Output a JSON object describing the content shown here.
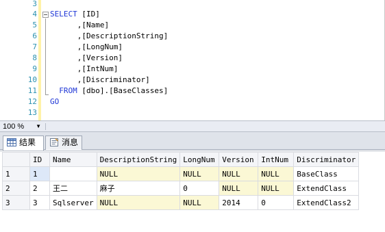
{
  "editor": {
    "line_numbers": [
      "3",
      "4",
      "5",
      "6",
      "7",
      "8",
      "9",
      "10",
      "11",
      "12",
      "13"
    ],
    "lines": [
      {
        "keyword": "",
        "text": ""
      },
      {
        "keyword": "SELECT",
        "text": " [ID]"
      },
      {
        "keyword": "",
        "text": "      ,[Name]"
      },
      {
        "keyword": "",
        "text": "      ,[DescriptionString]"
      },
      {
        "keyword": "",
        "text": "      ,[LongNum]"
      },
      {
        "keyword": "",
        "text": "      ,[Version]"
      },
      {
        "keyword": "",
        "text": "      ,[IntNum]"
      },
      {
        "keyword": "",
        "text": "      ,[Discriminator]"
      },
      {
        "keyword": "  FROM",
        "text": " [dbo].[BaseClasses]"
      },
      {
        "keyword": "GO",
        "text": ""
      },
      {
        "keyword": "",
        "text": ""
      }
    ]
  },
  "zoom": {
    "value": "100 %"
  },
  "tabs": [
    {
      "label": "结果",
      "icon": "grid-results-icon",
      "active": true
    },
    {
      "label": "消息",
      "icon": "messages-icon",
      "active": false
    }
  ],
  "results": {
    "columns": [
      "",
      "ID",
      "Name",
      "DescriptionString",
      "LongNum",
      "Version",
      "IntNum",
      "Discriminator"
    ],
    "rows": [
      [
        "1",
        "1",
        "",
        "NULL",
        "NULL",
        "NULL",
        "NULL",
        "BaseClass"
      ],
      [
        "2",
        "2",
        "王二",
        "麻子",
        "0",
        "NULL",
        "NULL",
        "ExtendClass"
      ],
      [
        "3",
        "3",
        "Sqlserver",
        "NULL",
        "NULL",
        "2014",
        "0",
        "ExtendClass2"
      ]
    ]
  },
  "colors": {
    "keyword": "#1d35d6",
    "line_number": "#2b91af",
    "null_cell": "#fbf8d5",
    "change_bar": "#fff2a8"
  }
}
